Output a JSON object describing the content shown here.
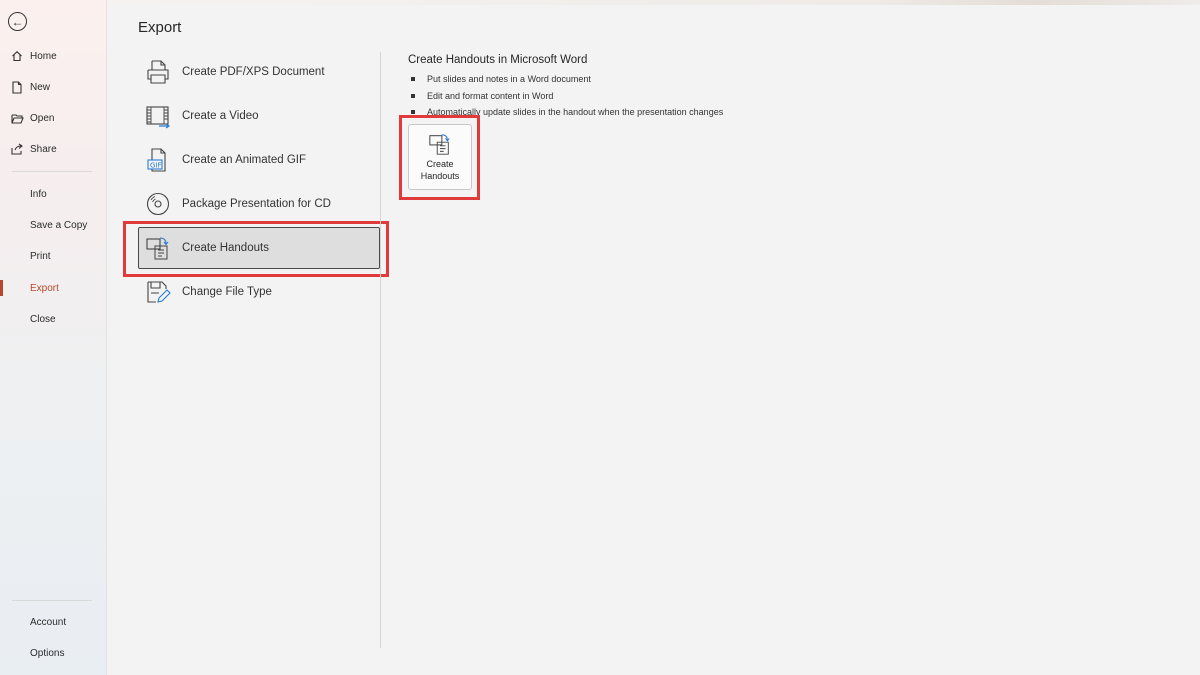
{
  "nav": {
    "back_icon": "back-arrow-icon",
    "primary": [
      {
        "label": "Home",
        "icon": "home-icon"
      },
      {
        "label": "New",
        "icon": "new-document-icon"
      },
      {
        "label": "Open",
        "icon": "open-folder-icon"
      },
      {
        "label": "Share",
        "icon": "share-icon"
      }
    ],
    "secondary": [
      "Info",
      "Save a Copy",
      "Print",
      "Export",
      "Close"
    ],
    "active": "Export",
    "footer": [
      "Account",
      "Options"
    ]
  },
  "page": {
    "title": "Export"
  },
  "options": [
    {
      "label": "Create PDF/XPS Document",
      "icon": "pdf-document-icon"
    },
    {
      "label": "Create a Video",
      "icon": "video-icon"
    },
    {
      "label": "Create an Animated GIF",
      "icon": "gif-icon"
    },
    {
      "label": "Package Presentation for CD",
      "icon": "cd-icon"
    },
    {
      "label": "Create Handouts",
      "icon": "handouts-icon"
    },
    {
      "label": "Change File Type",
      "icon": "change-file-type-icon"
    }
  ],
  "selected_option": "Create Handouts",
  "detail": {
    "title": "Create Handouts in Microsoft Word",
    "bullets": [
      "Put slides and notes in a Word document",
      "Edit and format content in Word",
      "Automatically update slides in the handout when the presentation changes"
    ],
    "button_line1": "Create",
    "button_line2": "Handouts"
  },
  "colors": {
    "accent": "#b7472a",
    "highlight": "#e03a3a"
  }
}
